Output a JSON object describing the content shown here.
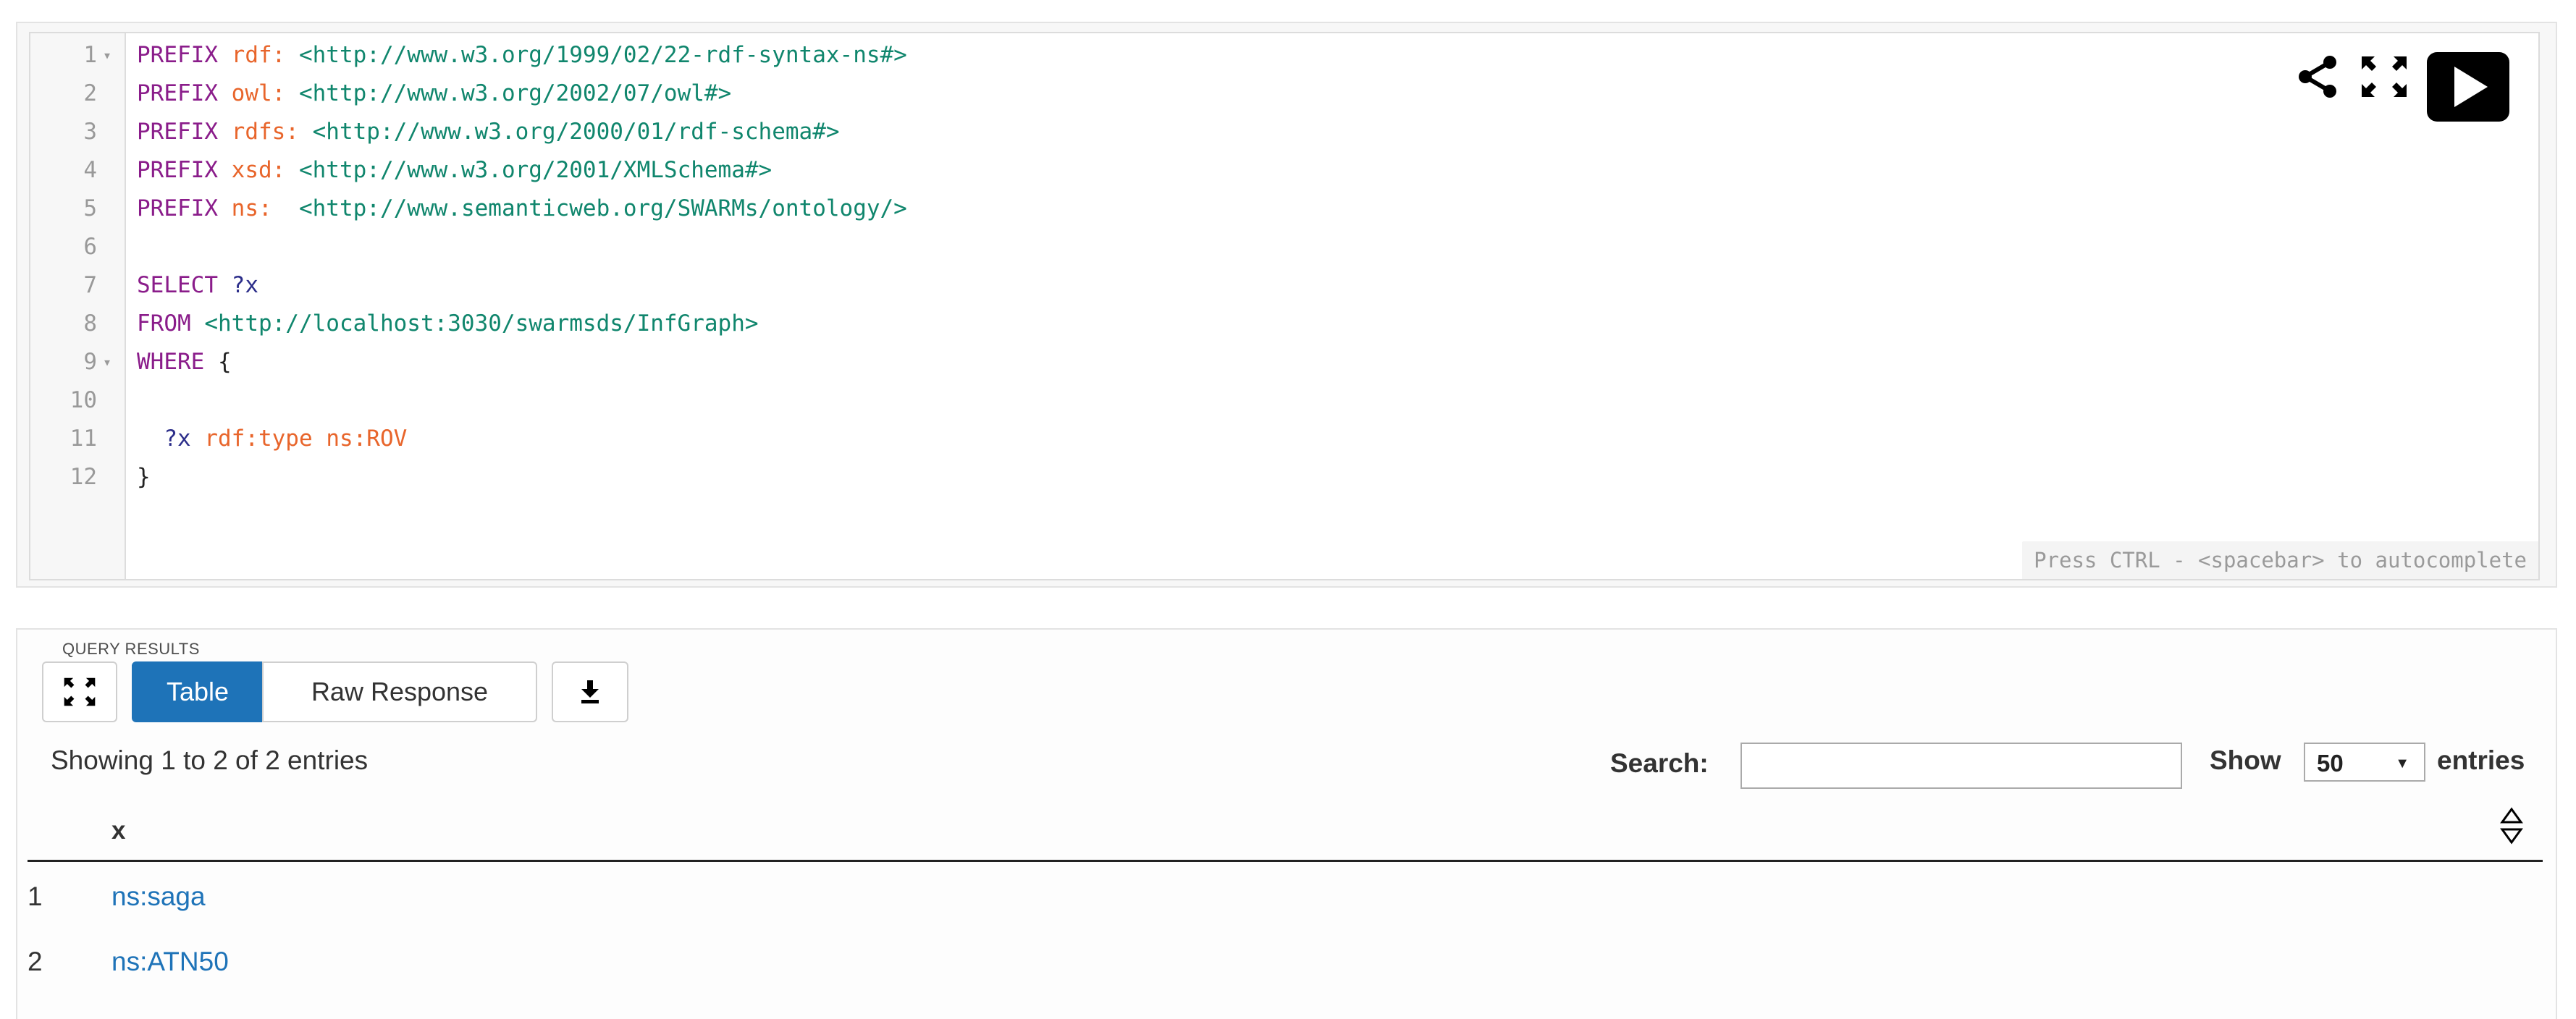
{
  "editor": {
    "lines": [
      {
        "num": "1",
        "fold": true,
        "tokens": [
          [
            "kw",
            "PREFIX "
          ],
          [
            "pfx",
            "rdf: "
          ],
          [
            "uri",
            "<http://www.w3.org/1999/02/22-rdf-syntax-ns#>"
          ]
        ]
      },
      {
        "num": "2",
        "fold": false,
        "tokens": [
          [
            "kw",
            "PREFIX "
          ],
          [
            "pfx",
            "owl: "
          ],
          [
            "uri",
            "<http://www.w3.org/2002/07/owl#>"
          ]
        ]
      },
      {
        "num": "3",
        "fold": false,
        "tokens": [
          [
            "kw",
            "PREFIX "
          ],
          [
            "pfx",
            "rdfs: "
          ],
          [
            "uri",
            "<http://www.w3.org/2000/01/rdf-schema#>"
          ]
        ]
      },
      {
        "num": "4",
        "fold": false,
        "tokens": [
          [
            "kw",
            "PREFIX "
          ],
          [
            "pfx",
            "xsd: "
          ],
          [
            "uri",
            "<http://www.w3.org/2001/XMLSchema#>"
          ]
        ]
      },
      {
        "num": "5",
        "fold": false,
        "tokens": [
          [
            "kw",
            "PREFIX "
          ],
          [
            "pfx",
            "ns:  "
          ],
          [
            "uri",
            "<http://www.semanticweb.org/SWARMs/ontology/>"
          ]
        ]
      },
      {
        "num": "6",
        "fold": false,
        "tokens": []
      },
      {
        "num": "7",
        "fold": false,
        "tokens": [
          [
            "kw",
            "SELECT "
          ],
          [
            "var",
            "?x"
          ]
        ]
      },
      {
        "num": "8",
        "fold": false,
        "tokens": [
          [
            "kw",
            "FROM "
          ],
          [
            "uri",
            "<http://localhost:3030/swarmsds/InfGraph>"
          ]
        ]
      },
      {
        "num": "9",
        "fold": true,
        "tokens": [
          [
            "kw",
            "WHERE "
          ],
          [
            "punc",
            "{"
          ]
        ]
      },
      {
        "num": "10",
        "fold": false,
        "tokens": []
      },
      {
        "num": "11",
        "fold": false,
        "tokens": [
          [
            "punc",
            "  "
          ],
          [
            "var",
            "?x "
          ],
          [
            "pfx",
            "rdf:type "
          ],
          [
            "pfx",
            "ns:ROV"
          ]
        ]
      },
      {
        "num": "12",
        "fold": false,
        "tokens": [
          [
            "punc",
            "}"
          ]
        ]
      }
    ],
    "autocomplete_hint": "Press CTRL - <spacebar> to autocomplete",
    "icons": {
      "share": "share-icon",
      "fullscreen": "fullscreen-icon",
      "run": "play-icon"
    }
  },
  "results": {
    "section_title": "QUERY RESULTS",
    "buttons": {
      "table": "Table",
      "raw": "Raw Response",
      "expand_icon": "expand-icon",
      "download_icon": "download-icon"
    },
    "info": "Showing 1 to 2 of 2 entries",
    "search": {
      "label": "Search:",
      "value": "",
      "placeholder": ""
    },
    "show": {
      "label": "Show",
      "selected": "50",
      "suffix": "entries"
    },
    "columns": [
      "x"
    ],
    "rows": [
      {
        "index": "1",
        "x": "ns:saga"
      },
      {
        "index": "2",
        "x": "ns:ATN50"
      }
    ]
  },
  "colors": {
    "keyword": "#8a1c8a",
    "prefix": "#e8652b",
    "uri": "#10866d",
    "variable": "#2c2e8a",
    "accent": "#1e73b8"
  }
}
